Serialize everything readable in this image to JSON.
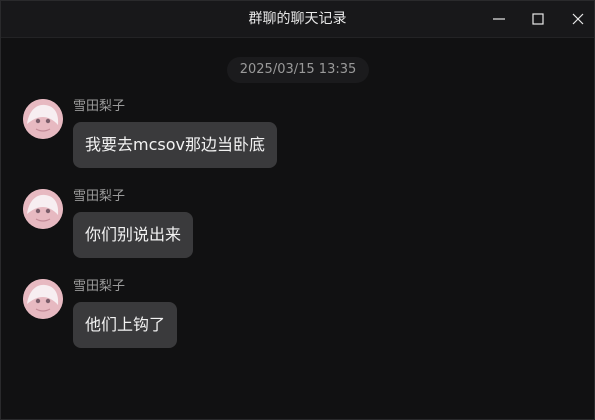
{
  "window": {
    "title": "群聊的聊天记录"
  },
  "controls": {
    "minimize_icon": "minimize-icon",
    "maximize_icon": "maximize-icon",
    "close_icon": "close-icon"
  },
  "chat": {
    "timestamp": "2025/03/15 13:35",
    "messages": [
      {
        "sender": "雪田梨子",
        "text": "我要去mcsov那边当卧底"
      },
      {
        "sender": "雪田梨子",
        "text": "你们别说出来"
      },
      {
        "sender": "雪田梨子",
        "text": "他们上钩了"
      }
    ]
  },
  "colors": {
    "background": "#111112",
    "bubble": "#3a3a3c",
    "sender_text": "#9b9b9b",
    "message_text": "#f2f2f2"
  }
}
